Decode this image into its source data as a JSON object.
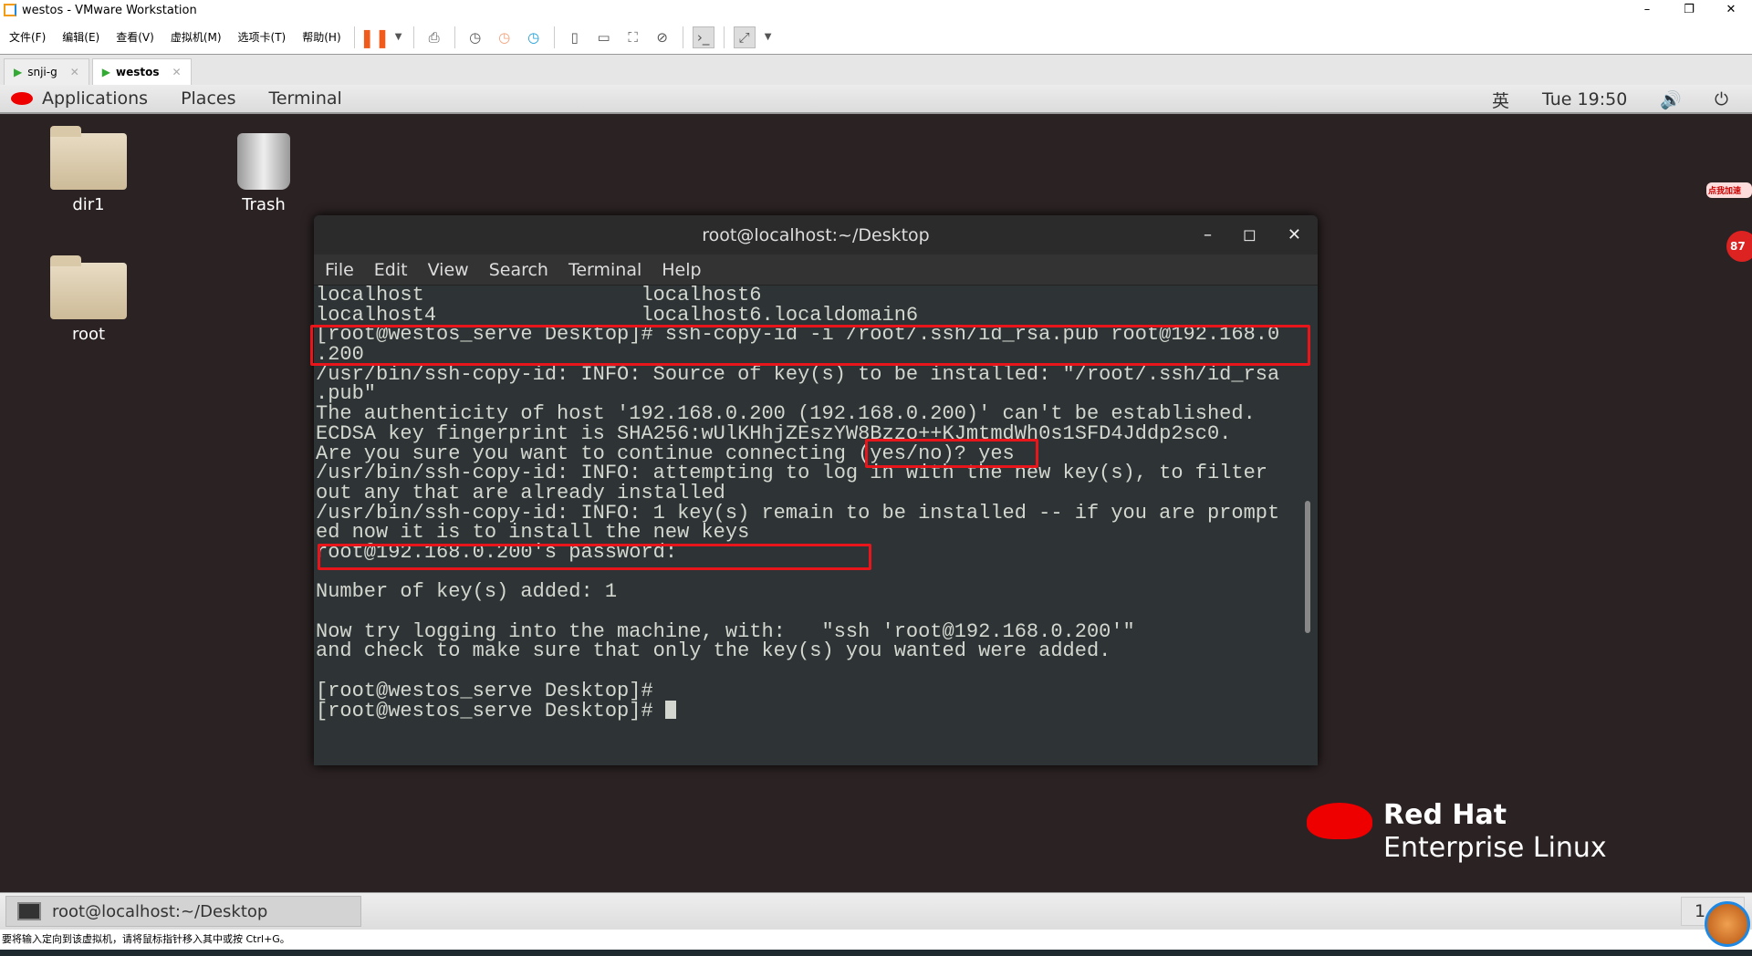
{
  "window": {
    "title": "westos - VMware Workstation",
    "controls": [
      "–",
      "❐",
      "✕"
    ]
  },
  "menu": [
    "文件(F)",
    "编辑(E)",
    "查看(V)",
    "虚拟机(M)",
    "选项卡(T)",
    "帮助(H)"
  ],
  "toolbar_icons": [
    "pause-icon",
    "dropdown-icon",
    "send-ctrl-alt-del-icon",
    "snapshot-icon",
    "revert-snapshot-icon",
    "snapshot-manager-icon",
    "sidebar-icon",
    "thumbnail-icon",
    "fullscreen-icon",
    "unity-icon",
    "console-icon",
    "stretch-icon"
  ],
  "tabs": [
    {
      "label": "snji-g",
      "active": false
    },
    {
      "label": "westos",
      "active": true
    }
  ],
  "gnome": {
    "menus": [
      "Applications",
      "Places",
      "Terminal"
    ],
    "input_method": "英",
    "clock": "Tue 19:50"
  },
  "desktop": {
    "icons": [
      "dir1",
      "Trash",
      "root"
    ]
  },
  "terminal": {
    "title": "root@localhost:~/Desktop",
    "menu": [
      "File",
      "Edit",
      "View",
      "Search",
      "Terminal",
      "Help"
    ],
    "lines": [
      "localhost                  localhost6",
      "localhost4                 localhost6.localdomain6",
      "[root@westos_serve Desktop]# ssh-copy-id -i /root/.ssh/id_rsa.pub root@192.168.0",
      ".200",
      "/usr/bin/ssh-copy-id: INFO: Source of key(s) to be installed: \"/root/.ssh/id_rsa",
      ".pub\"",
      "The authenticity of host '192.168.0.200 (192.168.0.200)' can't be established.",
      "ECDSA key fingerprint is SHA256:wUlKHhjZEszYW8Bzzo++KJmtmdWh0s1SFD4Jddp2sc0.",
      "Are you sure you want to continue connecting (yes/no)? yes",
      "/usr/bin/ssh-copy-id: INFO: attempting to log in with the new key(s), to filter",
      "out any that are already installed",
      "/usr/bin/ssh-copy-id: INFO: 1 key(s) remain to be installed -- if you are prompt",
      "ed now it is to install the new keys",
      "root@192.168.0.200's password: ",
      "",
      "Number of key(s) added: 1",
      "",
      "Now try logging into the machine, with:   \"ssh 'root@192.168.0.200'\"",
      "and check to make sure that only the key(s) you wanted were added.",
      "",
      "[root@westos_serve Desktop]# ",
      "[root@westos_serve Desktop]# "
    ]
  },
  "branding": {
    "line1": "Red Hat",
    "line2": "Enterprise Linux"
  },
  "promo": {
    "text": "点我加速",
    "badge": "87"
  },
  "taskbar": {
    "item": "root@localhost:~/Desktop",
    "pager": "1 / 4"
  },
  "statusbar": "要将输入定向到该虚拟机，请将鼠标指针移入其中或按 Ctrl+G。",
  "colors": {
    "highlight": "#e8161b",
    "terminal_bg": "#2e3436",
    "brand": "#ee0000"
  }
}
